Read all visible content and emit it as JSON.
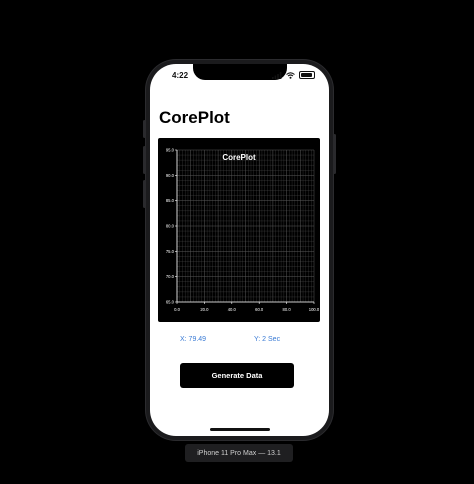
{
  "status_bar": {
    "time": "4:22"
  },
  "app": {
    "title": "CorePlot",
    "x_readout": "X: 79.49",
    "y_readout": "Y: 2 Sec",
    "generate_button": "Generate Data"
  },
  "device_label": "iPhone 11 Pro Max — 13.1",
  "chart_data": {
    "type": "line",
    "title": "CorePlot",
    "xlabel": "",
    "ylabel": "",
    "xlim": [
      0,
      100
    ],
    "ylim": [
      65,
      95
    ],
    "x_ticks": [
      "0.0",
      "20.0",
      "40.0",
      "60.0",
      "80.0",
      "100.0"
    ],
    "y_ticks": [
      "65.0",
      "70.0",
      "75.0",
      "80.0",
      "85.0",
      "90.0",
      "95.0"
    ],
    "grid": true,
    "series": []
  },
  "colors": {
    "chart_background": "#000000",
    "grid_line": "#5a5a5a",
    "axis_line": "#ffffff",
    "readout_text": "#3a7bd5",
    "button_background": "#000000"
  }
}
